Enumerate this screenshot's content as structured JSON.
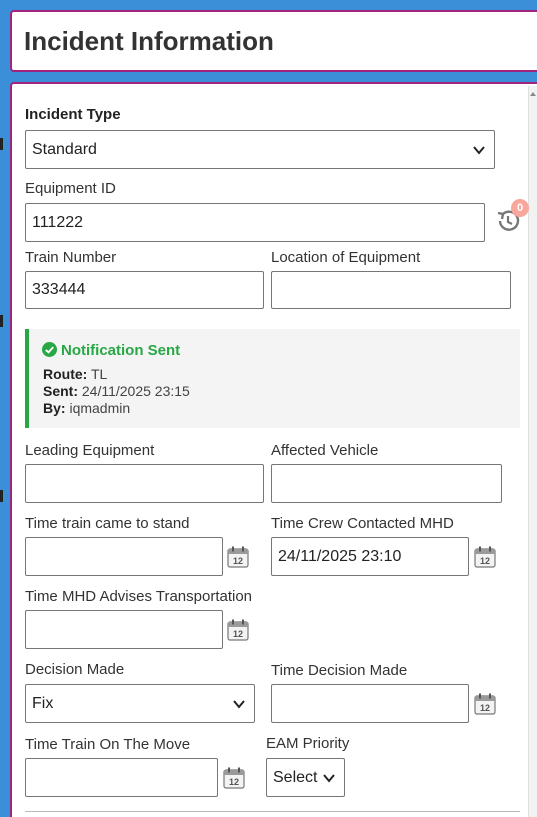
{
  "header": {
    "title": "Incident Information"
  },
  "incident_type": {
    "label": "Incident Type",
    "value": "Standard"
  },
  "equipment_id": {
    "label": "Equipment ID",
    "value": "111222",
    "history_count": "0"
  },
  "train_number": {
    "label": "Train Number",
    "value": "333444"
  },
  "location_of_equipment": {
    "label": "Location of Equipment",
    "value": ""
  },
  "notification": {
    "title": "Notification Sent",
    "route_label": "Route:",
    "route_value": "TL",
    "sent_label": "Sent:",
    "sent_value": "24/11/2025 23:15",
    "by_label": "By:",
    "by_value": "iqmadmin"
  },
  "leading_equipment": {
    "label": "Leading Equipment",
    "value": ""
  },
  "affected_vehicle": {
    "label": "Affected Vehicle",
    "value": ""
  },
  "time_train_stand": {
    "label": "Time train came to stand",
    "value": ""
  },
  "time_crew_contacted": {
    "label": "Time Crew Contacted MHD",
    "value": "24/11/2025 23:10"
  },
  "time_mhd_advises": {
    "label": "Time MHD Advises Transportation",
    "value": ""
  },
  "decision_made": {
    "label": "Decision Made",
    "value": "Fix"
  },
  "time_decision_made": {
    "label": "Time Decision Made",
    "value": ""
  },
  "time_train_on_move": {
    "label": "Time Train On The Move",
    "value": ""
  },
  "eam_priority": {
    "label": "EAM Priority",
    "value": "Select"
  },
  "calendar_icon_text": "12",
  "colors": {
    "accent_border": "#a0247c",
    "success": "#28a745",
    "background": "#3a8fd8"
  }
}
